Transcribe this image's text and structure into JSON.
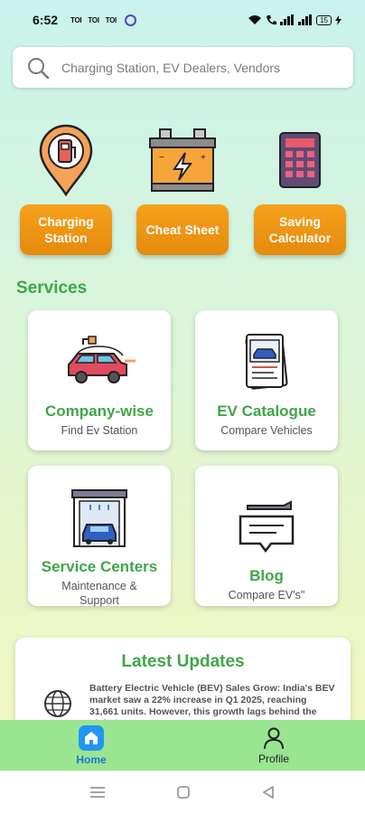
{
  "status_bar": {
    "time": "6:52",
    "notifications": [
      "TOI",
      "TOI",
      "TOI"
    ],
    "battery": "15"
  },
  "search": {
    "placeholder": "Charging Station, EV Dealers, Vendors"
  },
  "quick_actions": [
    {
      "label": "Charging Station",
      "icon": "charging-station-pin-icon"
    },
    {
      "label": "Cheat Sheet",
      "icon": "battery-icon"
    },
    {
      "label": "Saving Calculator",
      "icon": "calculator-icon"
    }
  ],
  "services": {
    "title": "Services",
    "cards": [
      {
        "title": "Company-wise",
        "subtitle": "Find Ev Station",
        "icon": "car-charging-icon"
      },
      {
        "title": "EV Catalogue",
        "subtitle": "Compare Vehicles",
        "icon": "catalogue-icon"
      },
      {
        "title": "Service Centers",
        "subtitle": "Maintenance & Support",
        "icon": "garage-icon"
      },
      {
        "title": "Blog",
        "subtitle": "Compare EV's\"",
        "icon": "blog-icon"
      }
    ]
  },
  "latest_updates": {
    "title": "Latest Updates",
    "items": [
      {
        "text": "Battery Electric Vehicle (BEV) Sales Grow: India's BEV market saw a 22% increase in Q1 2025, reaching 31,661 units. However, this growth lags behind the global",
        "icon": "globe-icon"
      }
    ]
  },
  "bottom_nav": {
    "home": "Home",
    "profile": "Profile"
  },
  "colors": {
    "accent_green": "#3fa64a",
    "button_orange": "#f29a18",
    "nav_green": "#99e591",
    "home_blue": "#2196f3"
  }
}
